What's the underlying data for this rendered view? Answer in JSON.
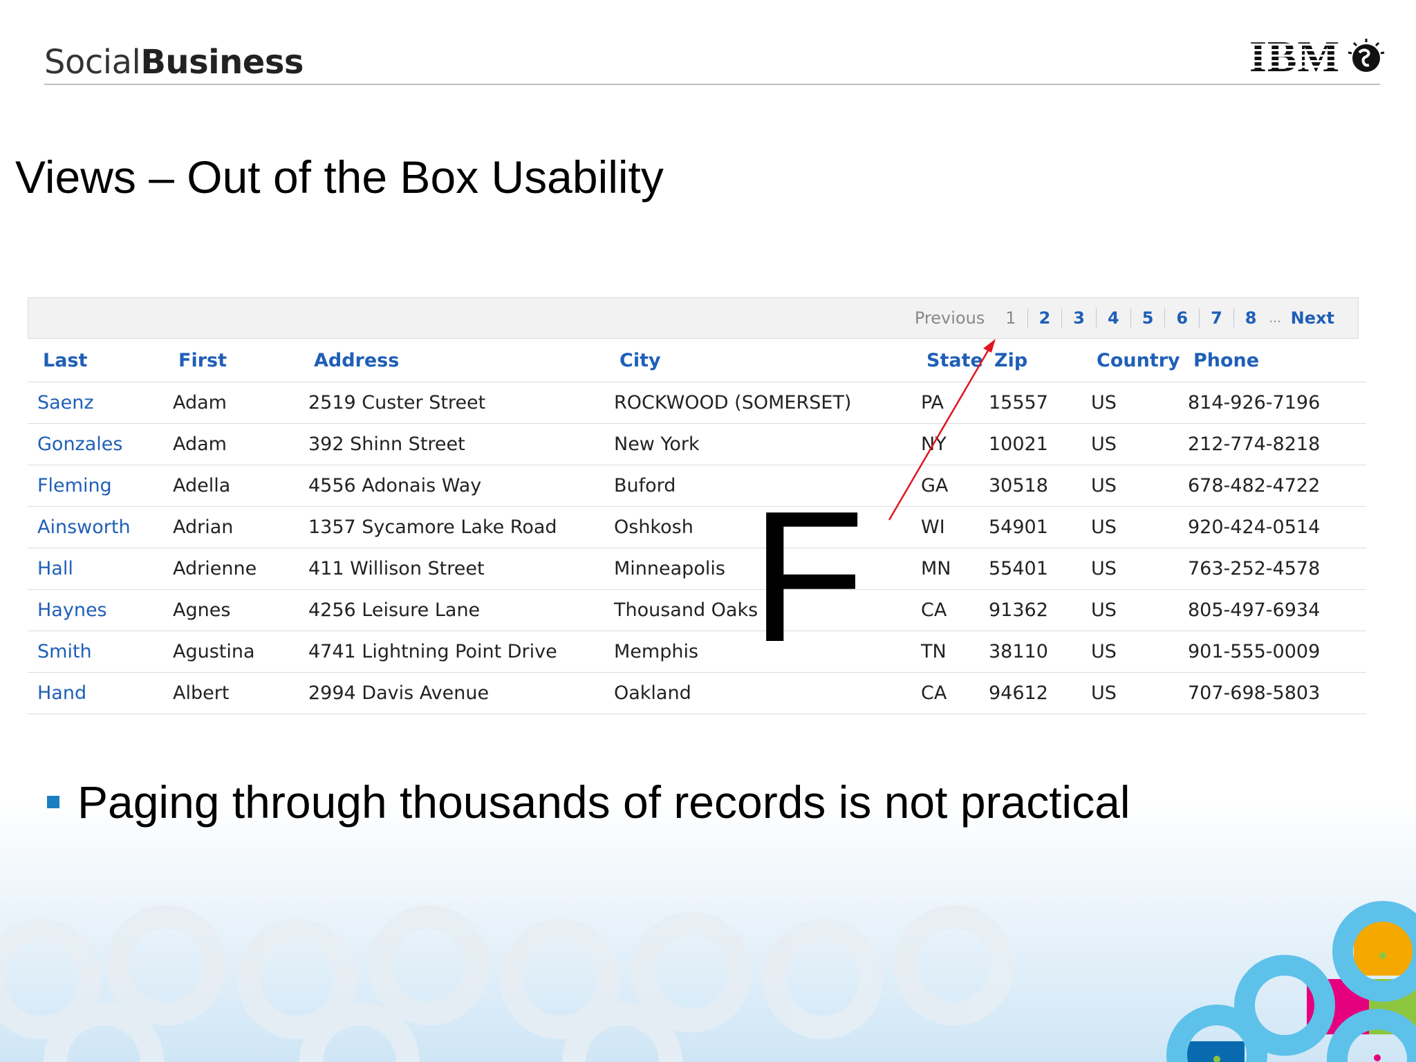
{
  "header": {
    "brand_light": "Social",
    "brand_bold": "Business",
    "ibm_logo_text": "IBM"
  },
  "slide": {
    "title": "Views – Out of the Box Usability",
    "bullet": "Paging through thousands of records is not practical"
  },
  "pager": {
    "previous": "Previous",
    "current": "1",
    "pages": [
      "2",
      "3",
      "4",
      "5",
      "6",
      "7",
      "8"
    ],
    "ellipsis": "...",
    "next": "Next"
  },
  "table": {
    "columns": [
      "Last",
      "First",
      "Address",
      "City",
      "State",
      "Zip",
      "Country",
      "Phone"
    ],
    "rows": [
      [
        "Saenz",
        "Adam",
        "2519 Custer Street",
        "ROCKWOOD (SOMERSET)",
        "PA",
        "15557",
        "US",
        "814-926-7196"
      ],
      [
        "Gonzales",
        "Adam",
        "392 Shinn Street",
        "New York",
        "NY",
        "10021",
        "US",
        "212-774-8218"
      ],
      [
        "Fleming",
        "Adella",
        "4556 Adonais Way",
        "Buford",
        "GA",
        "30518",
        "US",
        "678-482-4722"
      ],
      [
        "Ainsworth",
        "Adrian",
        "1357 Sycamore Lake Road",
        "Oshkosh",
        "WI",
        "54901",
        "US",
        "920-424-0514"
      ],
      [
        "Hall",
        "Adrienne",
        "411 Willison Street",
        "Minneapolis",
        "MN",
        "55401",
        "US",
        "763-252-4578"
      ],
      [
        "Haynes",
        "Agnes",
        "4256 Leisure Lane",
        "Thousand Oaks",
        "CA",
        "91362",
        "US",
        "805-497-6934"
      ],
      [
        "Smith",
        "Agustina",
        "4741 Lightning Point Drive",
        "Memphis",
        "TN",
        "38110",
        "US",
        "901-555-0009"
      ],
      [
        "Hand",
        "Albert",
        "2994 Davis Avenue",
        "Oakland",
        "CA",
        "94612",
        "US",
        "707-698-5803"
      ]
    ]
  },
  "annotation": {
    "letter": "F",
    "arrow_color": "#e0141e"
  },
  "colors": {
    "link_blue": "#1f5fb8",
    "bullet_blue": "#1a7fc1"
  }
}
